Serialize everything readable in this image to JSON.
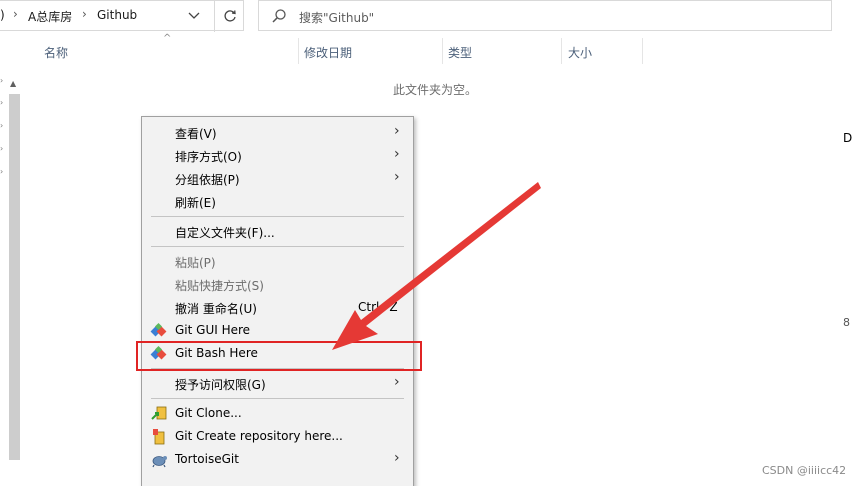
{
  "address": {
    "crumbs": [
      ")",
      "A总库房",
      "Github"
    ]
  },
  "search": {
    "placeholder": "搜索\"Github\""
  },
  "columns": [
    "名称",
    "修改日期",
    "类型",
    "大小"
  ],
  "empty_message": "此文件夹为空。",
  "right_fragments": [
    "D",
    "8"
  ],
  "context_menu": {
    "items": [
      {
        "label": "查看(V)",
        "submenu": true
      },
      {
        "label": "排序方式(O)",
        "submenu": true
      },
      {
        "label": "分组依据(P)",
        "submenu": true
      },
      {
        "label": "刷新(E)"
      },
      {
        "label": "自定义文件夹(F)..."
      },
      {
        "label": "粘贴(P)",
        "disabled": true
      },
      {
        "label": "粘贴快捷方式(S)",
        "disabled": true
      },
      {
        "label": "撤消 重命名(U)",
        "shortcut": "Ctrl+Z"
      },
      {
        "label": "Git GUI Here",
        "icon": "git-icon"
      },
      {
        "label": "Git Bash Here",
        "icon": "git-icon"
      },
      {
        "label": "授予访问权限(G)",
        "submenu": true
      },
      {
        "label": "Git Clone...",
        "icon": "tortoisegit-clone-icon"
      },
      {
        "label": "Git Create repository here...",
        "icon": "tortoisegit-create-icon"
      },
      {
        "label": "TortoiseGit",
        "icon": "tortoisegit-icon",
        "submenu": true
      }
    ]
  },
  "annotation": {
    "highlight_color": "#e02424"
  },
  "watermark": "CSDN @iiiicc42"
}
